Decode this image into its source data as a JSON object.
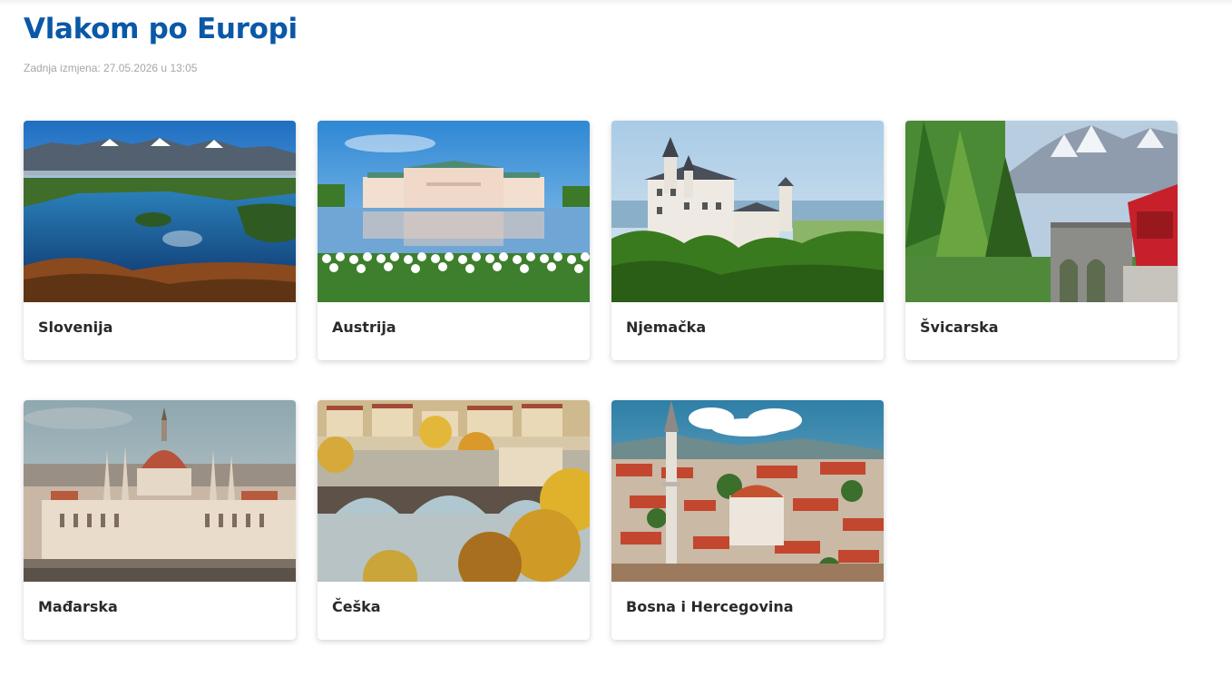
{
  "page": {
    "title": "Vlakom po Europi",
    "last_modified": "Zadnja izmjena: 27.05.2026 u 13:05"
  },
  "cards": [
    {
      "label": "Slovenija",
      "image": "lake-bled-photo"
    },
    {
      "label": "Austrija",
      "image": "belvedere-palace-photo"
    },
    {
      "label": "Njemačka",
      "image": "neuschwanstein-castle-photo"
    },
    {
      "label": "Švicarska",
      "image": "red-train-viaduct-photo"
    },
    {
      "label": "Mađarska",
      "image": "budapest-parliament-photo"
    },
    {
      "label": "Češka",
      "image": "prague-charles-bridge-photo"
    },
    {
      "label": "Bosna i Hercegovina",
      "image": "mosque-minaret-town-photo"
    }
  ]
}
